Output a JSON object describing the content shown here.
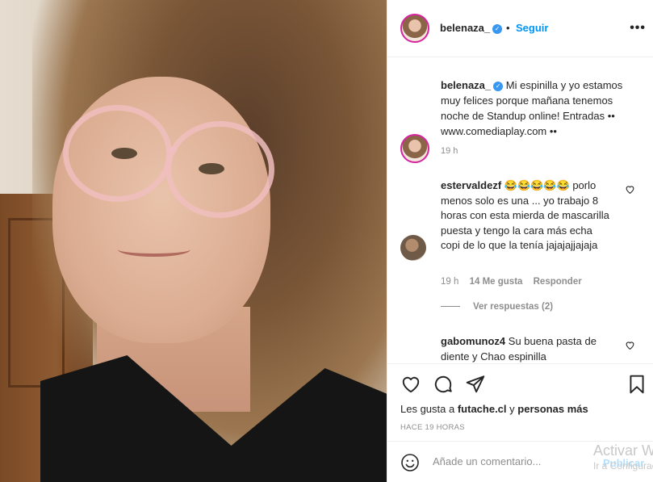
{
  "header": {
    "username": "belenaza_",
    "separator": "•",
    "follow_label": "Seguir",
    "more_icon": "more-horizontal-icon"
  },
  "caption": {
    "username": "belenaza_",
    "text": "Mi espinilla y yo estamos muy felices porque mañana tenemos noche de Standup online! Entradas •• www.comediaplay.com ••",
    "time": "19 h"
  },
  "comments": [
    {
      "username": "estervaldezf",
      "text": "😂😂😂😂😂 porlo menos solo es una ... yo trabajo 8 horas con esta mierda de mascarilla puesta y tengo la cara más echa copi de lo que la tenía jajajajjajaja",
      "time": "19 h",
      "likes": "14 Me gusta",
      "reply_label": "Responder",
      "view_replies": "Ver respuestas (2)"
    },
    {
      "username": "gabomunoz4",
      "text": "Su buena pasta de diente y Chao espinilla"
    }
  ],
  "likes": {
    "prefix": "Les gusta a",
    "user": "futache.cl",
    "connector": "y",
    "others": "personas más"
  },
  "post_time": "HACE 19 HORAS",
  "add_comment": {
    "placeholder": "Añade un comentario...",
    "publish_label": "Publicar"
  },
  "watermark": {
    "title": "Activar Windows",
    "subtitle": "Ir a Configuración"
  },
  "colors": {
    "link_blue": "#0095f6",
    "verified_blue": "#3897f0",
    "muted": "#8e8e8e"
  }
}
